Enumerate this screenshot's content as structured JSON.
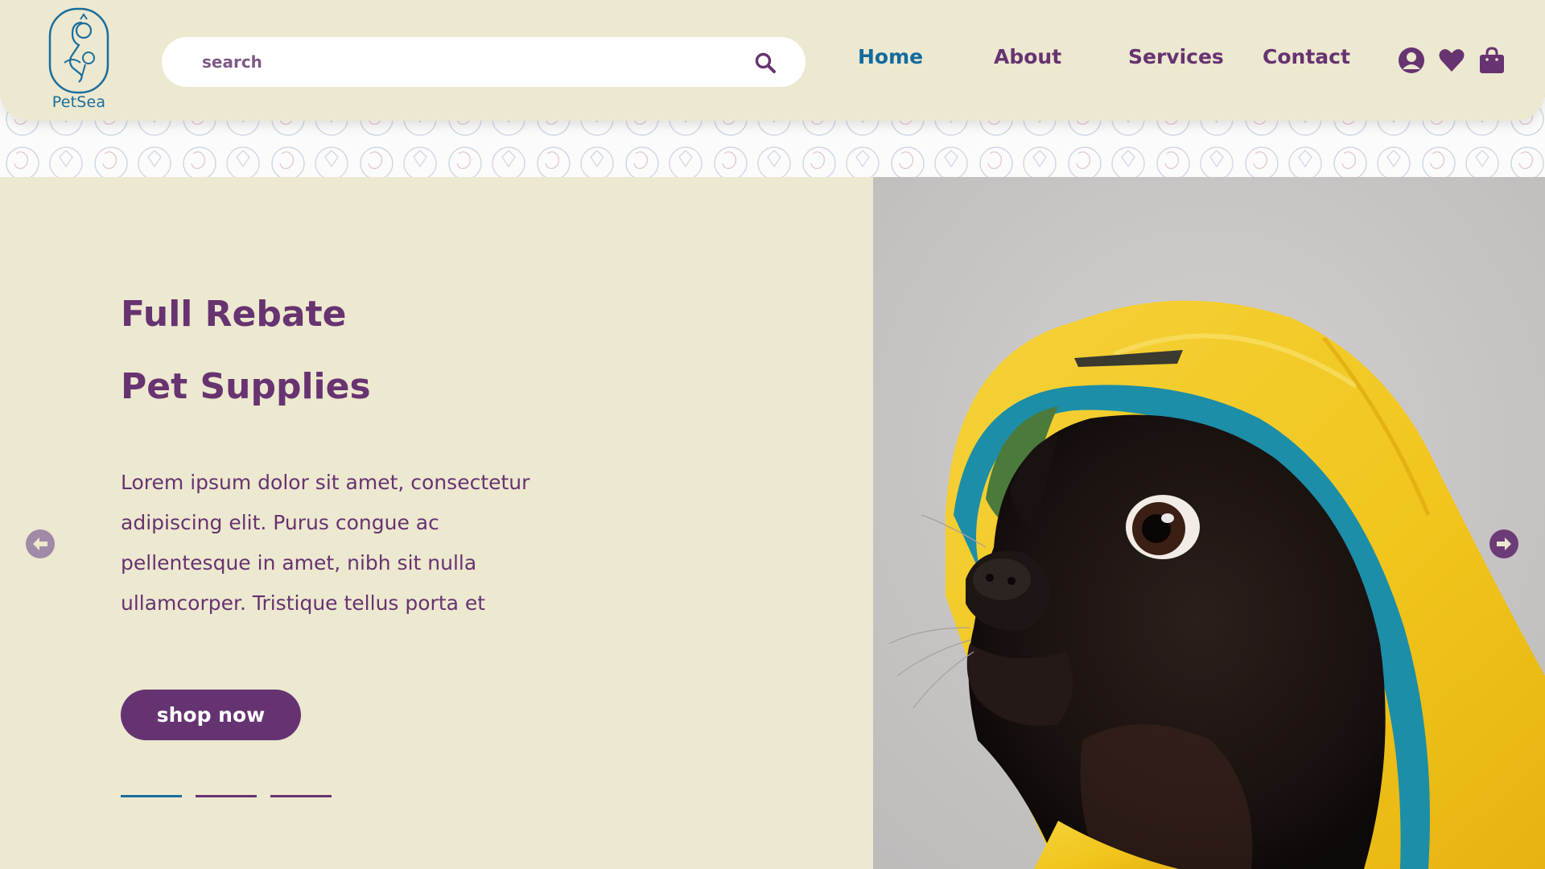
{
  "brand": {
    "name": "PetSea"
  },
  "search": {
    "placeholder": "search"
  },
  "nav": {
    "items": [
      "Home",
      "About",
      "Services",
      "Contact"
    ],
    "active": "Home"
  },
  "header_icons": [
    "user-icon",
    "heart-icon",
    "shopping-bag-icon"
  ],
  "hero": {
    "title_line1": "Full Rebate",
    "title_line2": "Pet Supplies",
    "description": "Lorem ipsum dolor sit amet, consectetur adipiscing elit. Purus congue ac pellentesque in amet, nibh sit nulla ullamcorper. Tristique tellus porta et",
    "cta_label": "shop now",
    "slides_count": 3,
    "active_slide": 1
  },
  "colors": {
    "background": "#ede8d0",
    "primary_purple": "#673370",
    "accent_blue": "#1a6e9c",
    "raincoat_yellow": "#f2c820"
  }
}
